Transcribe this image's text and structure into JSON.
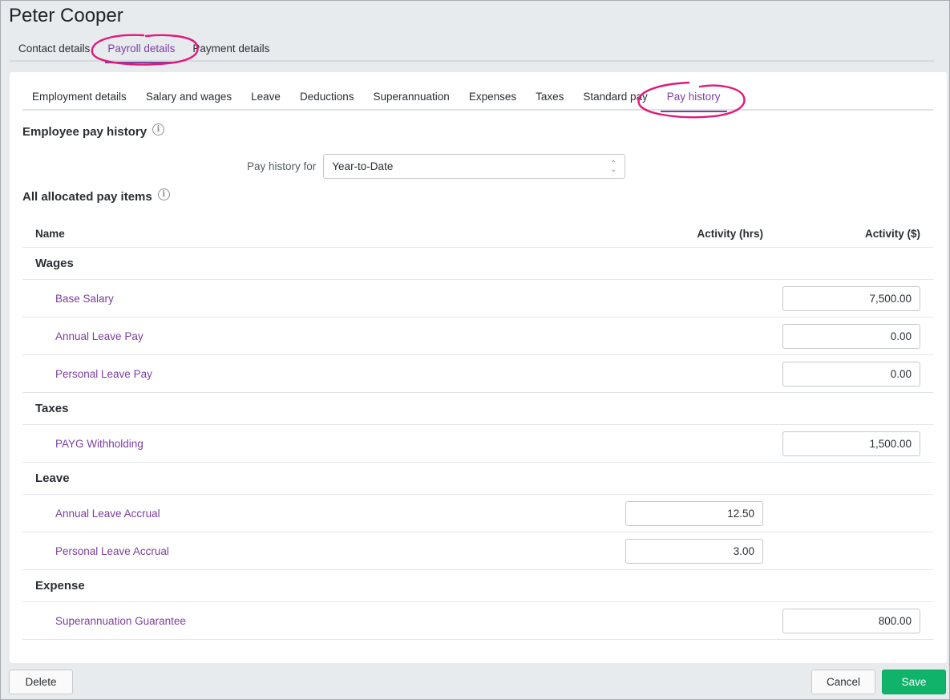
{
  "page": {
    "title": "Peter Cooper"
  },
  "top_tabs": [
    {
      "label": "Contact details",
      "active": false
    },
    {
      "label": "Payroll details",
      "active": true
    },
    {
      "label": "Payment details",
      "active": false
    }
  ],
  "sub_tabs": [
    {
      "label": "Employment details",
      "active": false
    },
    {
      "label": "Salary and wages",
      "active": false
    },
    {
      "label": "Leave",
      "active": false
    },
    {
      "label": "Deductions",
      "active": false
    },
    {
      "label": "Superannuation",
      "active": false
    },
    {
      "label": "Expenses",
      "active": false
    },
    {
      "label": "Taxes",
      "active": false
    },
    {
      "label": "Standard pay",
      "active": false
    },
    {
      "label": "Pay history",
      "active": true
    }
  ],
  "employee_pay_history": {
    "heading": "Employee pay history",
    "info_icon": "info-icon",
    "filter_label": "Pay history for",
    "filter_value": "Year-to-Date"
  },
  "allocated_items": {
    "heading": "All allocated pay items",
    "info_icon": "info-icon",
    "columns": {
      "name": "Name",
      "activity_hrs": "Activity (hrs)",
      "activity_amount": "Activity ($)"
    },
    "groups": [
      {
        "name": "Wages",
        "items": [
          {
            "name": "Base Salary",
            "hours": null,
            "amount": "7,500.00"
          },
          {
            "name": "Annual Leave Pay",
            "hours": null,
            "amount": "0.00"
          },
          {
            "name": "Personal Leave Pay",
            "hours": null,
            "amount": "0.00"
          }
        ]
      },
      {
        "name": "Taxes",
        "items": [
          {
            "name": "PAYG Withholding",
            "hours": null,
            "amount": "1,500.00"
          }
        ]
      },
      {
        "name": "Leave",
        "items": [
          {
            "name": "Annual Leave Accrual",
            "hours": "12.50",
            "amount": null
          },
          {
            "name": "Personal Leave Accrual",
            "hours": "3.00",
            "amount": null
          }
        ]
      },
      {
        "name": "Expense",
        "items": [
          {
            "name": "Superannuation Guarantee",
            "hours": null,
            "amount": "800.00"
          }
        ]
      }
    ]
  },
  "footer": {
    "delete_label": "Delete",
    "cancel_label": "Cancel",
    "save_label": "Save"
  },
  "colors": {
    "accent": "#7b3fa0",
    "save_button": "#0fb36a",
    "annotation": "#e0197d"
  }
}
